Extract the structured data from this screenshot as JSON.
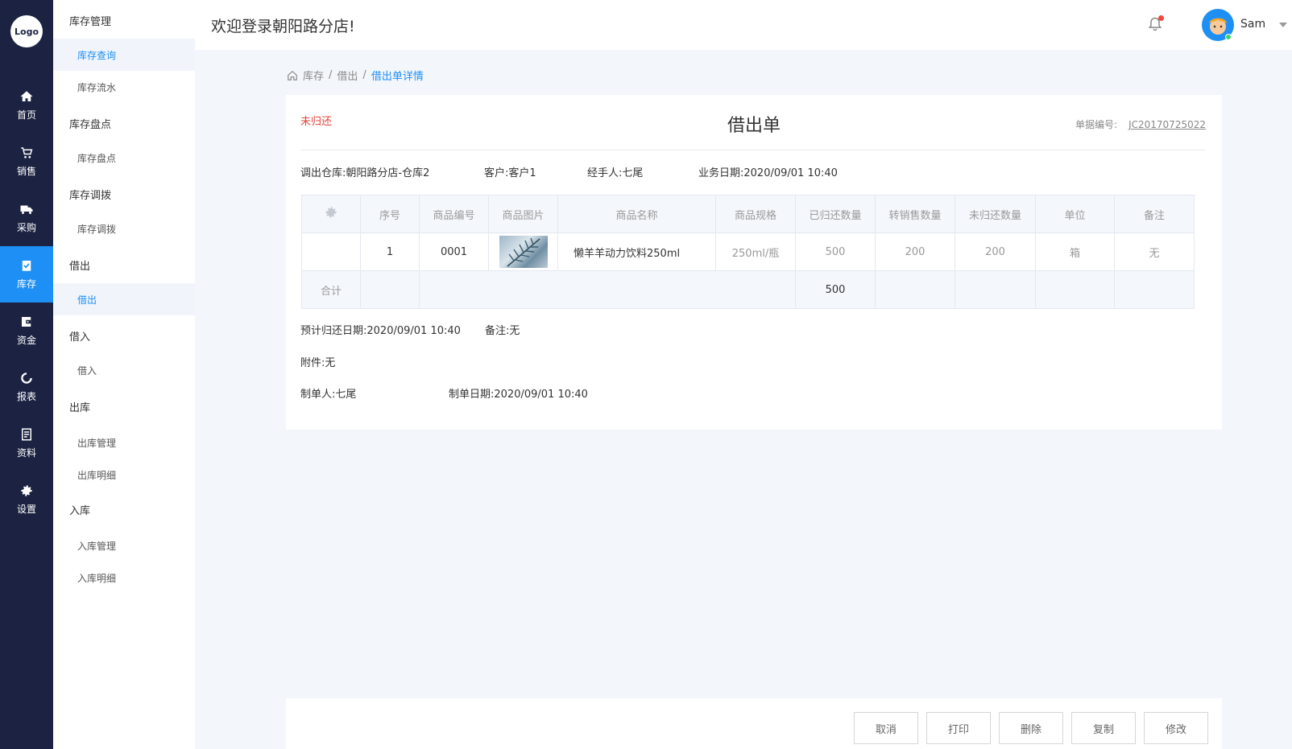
{
  "rail": {
    "logo": "Logo",
    "items": [
      {
        "label": "首页",
        "icon": "home-icon"
      },
      {
        "label": "销售",
        "icon": "cart-icon"
      },
      {
        "label": "采购",
        "icon": "truck-icon"
      },
      {
        "label": "库存",
        "icon": "clipboard-check-icon",
        "active": true
      },
      {
        "label": "资金",
        "icon": "wallet-icon"
      },
      {
        "label": "报表",
        "icon": "chart-ring-icon"
      },
      {
        "label": "资料",
        "icon": "document-icon"
      },
      {
        "label": "设置",
        "icon": "gear-icon"
      }
    ],
    "accent": "#1e8ff5",
    "background": "#1c2342"
  },
  "submenu": {
    "groups": [
      {
        "title": "库存管理",
        "items": [
          "库存查询",
          "库存流水"
        ]
      },
      {
        "title": "库存盘点",
        "items": [
          "库存盘点"
        ]
      },
      {
        "title": "库存调拨",
        "items": [
          "库存调拨"
        ]
      },
      {
        "title": "借出",
        "items": [
          "借出"
        ]
      },
      {
        "title": "借入",
        "items": [
          "借入"
        ]
      },
      {
        "title": "出库",
        "items": [
          "出库管理",
          "出库明细"
        ]
      },
      {
        "title": "入库",
        "items": [
          "入库管理",
          "入库明细"
        ]
      }
    ]
  },
  "topbar": {
    "welcome": "欢迎登录朝阳路分店!",
    "user": "Sam"
  },
  "breadcrumb": {
    "items": [
      "库存",
      "借出"
    ],
    "current": "借出单详情"
  },
  "doc": {
    "status": "未归还",
    "title": "借出单",
    "no_label": "单据编号:",
    "no_value": "JC20170725022",
    "warehouse": "调出仓库:朝阳路分店-仓库2",
    "customer": "客户:客户1",
    "handler": "经手人:七尾",
    "biz_date": "业务日期:2020/09/01 10:40"
  },
  "table": {
    "headers": [
      "序号",
      "商品编号",
      "商品图片",
      "商品名称",
      "商品规格",
      "已归还数量",
      "转销售数量",
      "未归还数量",
      "单位",
      "备注"
    ],
    "rows": [
      {
        "idx": "1",
        "code": "0001",
        "name": "懒羊羊动力饮料250ml",
        "spec": "250ml/瓶",
        "returned": "500",
        "to_sale": "200",
        "unreturned": "200",
        "unit": "箱",
        "remark": "无"
      }
    ],
    "total_label": "合计",
    "total_returned": "500"
  },
  "details": {
    "expected_return": "预计归还日期:2020/09/01 10:40",
    "remark": "备注:无",
    "attachment": "附件:无",
    "creator": "制单人:七尾",
    "created_at": "制单日期:2020/09/01 10:40"
  },
  "actions": {
    "cancel": "取消",
    "print": "打印",
    "delete": "删除",
    "copy": "复制",
    "edit": "修改"
  }
}
